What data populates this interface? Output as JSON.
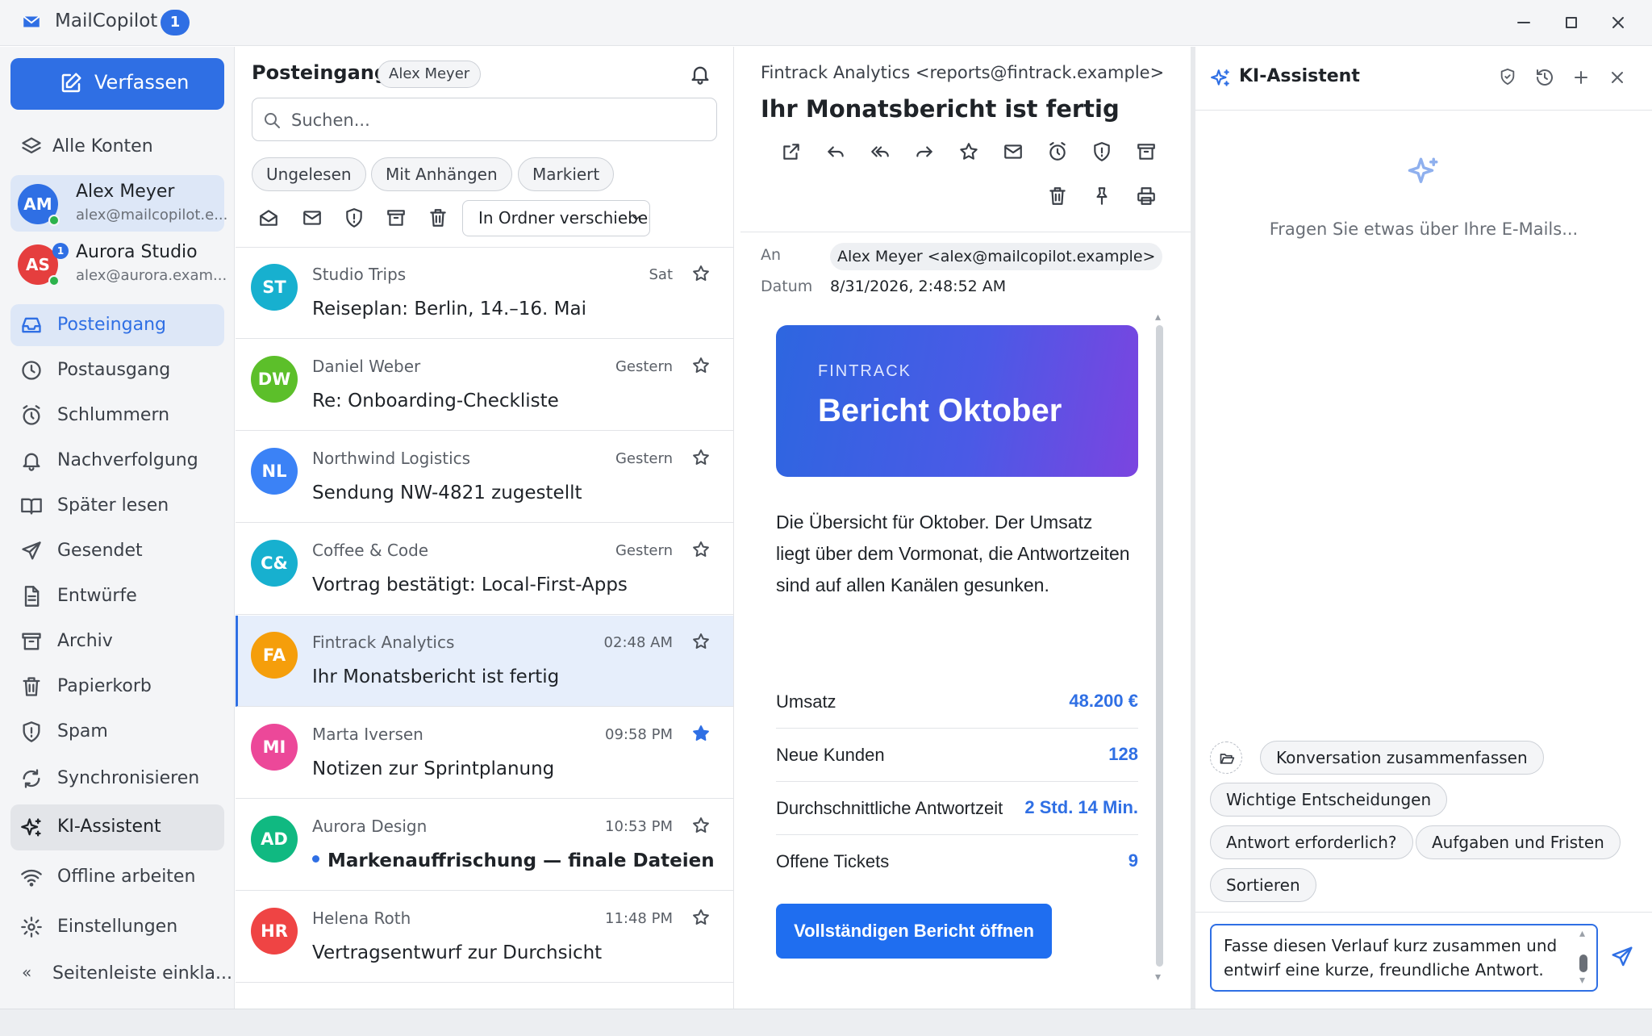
{
  "app": {
    "title": "MailCopilot",
    "badge": "1"
  },
  "sidebar": {
    "compose_label": "Verfassen",
    "all_accounts": "Alle Konten",
    "accounts": [
      {
        "initials": "AM",
        "name": "Alex Meyer",
        "email": "alex@mailcopilot.e...",
        "color": "#2f6fe4"
      },
      {
        "initials": "AS",
        "name": "Aurora Studio",
        "email": "alex@aurora.exam...",
        "color": "#e53e3e",
        "badge": "1"
      }
    ],
    "folders": [
      {
        "label": "Posteingang",
        "icon": "inbox-icon"
      },
      {
        "label": "Postausgang",
        "icon": "clock-icon"
      },
      {
        "label": "Schlummern",
        "icon": "alarm-icon"
      },
      {
        "label": "Nachverfolgung",
        "icon": "bell-icon"
      },
      {
        "label": "Später lesen",
        "icon": "book-icon"
      },
      {
        "label": "Gesendet",
        "icon": "send-icon"
      },
      {
        "label": "Entwürfe",
        "icon": "file-icon"
      },
      {
        "label": "Archiv",
        "icon": "archive-icon"
      },
      {
        "label": "Papierkorb",
        "icon": "trash-icon"
      },
      {
        "label": "Spam",
        "icon": "shield-icon"
      },
      {
        "label": "Synchronisieren",
        "icon": "sync-icon"
      },
      {
        "label": "KI-Assistent",
        "icon": "sparkles-icon"
      },
      {
        "label": "Offline arbeiten",
        "icon": "wifi-icon"
      },
      {
        "label": "Einstellungen",
        "icon": "gear-icon"
      }
    ],
    "collapse_label": "Seitenleiste einkla..."
  },
  "list": {
    "title": "Posteingang",
    "account_chip": "Alex Meyer",
    "search_placeholder": "Suchen...",
    "filters": [
      "Ungelesen",
      "Mit Anhängen",
      "Markiert"
    ],
    "move_to_folder": "In Ordner verschieben",
    "messages": [
      {
        "initials": "ST",
        "color": "#17b0cf",
        "sender": "Studio Trips",
        "time": "Sat",
        "subject": "Reiseplan: Berlin, 14.–16. Mai",
        "starred": false,
        "unread": false
      },
      {
        "initials": "DW",
        "color": "#5cbf2a",
        "sender": "Daniel Weber",
        "time": "Gestern",
        "subject": "Re: Onboarding-Checkliste",
        "starred": false,
        "unread": false
      },
      {
        "initials": "NL",
        "color": "#3b82f6",
        "sender": "Northwind Logistics",
        "time": "Gestern",
        "subject": "Sendung NW-4821 zugestellt",
        "starred": false,
        "unread": false
      },
      {
        "initials": "C&",
        "color": "#17b0cf",
        "sender": "Coffee & Code",
        "time": "Gestern",
        "subject": "Vortrag bestätigt: Local-First-Apps",
        "starred": false,
        "unread": false
      },
      {
        "initials": "FA",
        "color": "#f59e0b",
        "sender": "Fintrack Analytics",
        "time": "02:48 AM",
        "subject": "Ihr Monatsbericht ist fertig",
        "starred": false,
        "unread": false,
        "selected": true
      },
      {
        "initials": "MI",
        "color": "#ec4899",
        "sender": "Marta Iversen",
        "time": "09:58 PM",
        "subject": "Notizen zur Sprintplanung",
        "starred": true,
        "unread": false
      },
      {
        "initials": "AD",
        "color": "#10b981",
        "sender": "Aurora Design",
        "time": "10:53 PM",
        "subject": "Markenauffrischung — finale Dateien",
        "starred": false,
        "unread": true
      },
      {
        "initials": "HR",
        "color": "#ef4444",
        "sender": "Helena Roth",
        "time": "11:48 PM",
        "subject": "Vertragsentwurf zur Durchsicht",
        "starred": false,
        "unread": false
      }
    ]
  },
  "reader": {
    "from": "Fintrack Analytics <reports@fintrack.example>",
    "subject": "Ihr Monatsbericht ist fertig",
    "to_label": "An",
    "to_value": "Alex Meyer <alex@mailcopilot.example>",
    "date_label": "Datum",
    "date_value": "8/31/2026, 2:48:52 AM",
    "hero_brand": "FINTRACK",
    "hero_title": "Bericht Oktober",
    "body": "Die Übersicht für Oktober. Der Umsatz liegt über dem Vormonat, die Antwortzeiten sind auf allen Kanälen gesunken.",
    "stats": [
      {
        "label": "Umsatz",
        "value": "48.200 €"
      },
      {
        "label": "Neue Kunden",
        "value": "128"
      },
      {
        "label": "Durchschnittliche Antwortzeit",
        "value": "2 Std. 14 Min."
      },
      {
        "label": "Offene Tickets",
        "value": "9"
      }
    ],
    "cta": "Vollständigen Bericht öffnen"
  },
  "ai": {
    "title": "KI-Assistent",
    "empty_prompt": "Fragen Sie etwas über Ihre E-Mails...",
    "chips": [
      "Konversation zusammenfassen",
      "Wichtige Entscheidungen",
      "Antwort erforderlich?",
      "Aufgaben und Fristen",
      "Sortieren"
    ],
    "input_text": "Fasse diesen Verlauf kurz zusammen und entwirf eine kurze, freundliche Antwort."
  }
}
